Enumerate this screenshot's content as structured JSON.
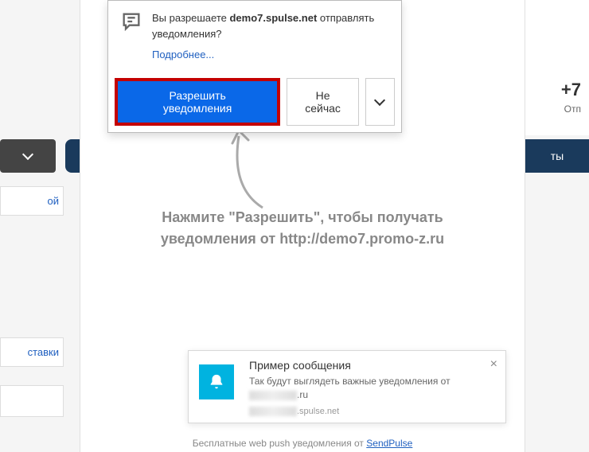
{
  "background": {
    "phone_prefix": "+7",
    "phone_sub": "Отп",
    "nav_button": "ты",
    "sidebar": {
      "item1": "ой",
      "item2": "ставки",
      "item3": ""
    }
  },
  "permission": {
    "prompt_prefix": "Вы разрешаете ",
    "prompt_domain": "demo7.spulse.net",
    "prompt_suffix": " отправлять уведомления?",
    "more_link": "Подробнее...",
    "allow_button": "Разрешить уведомления",
    "notnow_button": "Не сейчас"
  },
  "instruction": {
    "line1": "Нажмите \"Разрешить\", чтобы получать",
    "line2_prefix": "уведомления от ",
    "line2_url": "http://demo7.promo-z.ru"
  },
  "sample": {
    "title": "Пример сообщения",
    "desc": "Так будут выглядеть важные уведомления от",
    "domain_suffix": ".ru",
    "source_suffix": ".spulse.net"
  },
  "footer": {
    "text": "Бесплатные web push уведомления от ",
    "link": "SendPulse"
  }
}
